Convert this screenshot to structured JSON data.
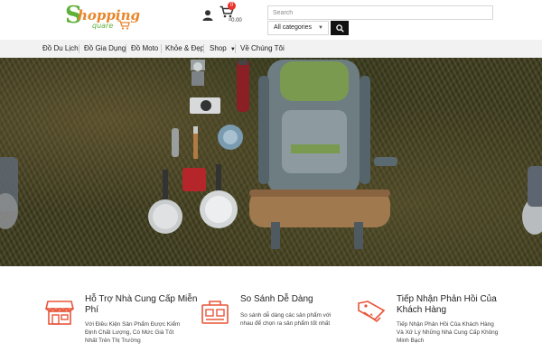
{
  "header": {
    "logo": {
      "big_letter": "S",
      "word1": "hopping",
      "word2": "quare"
    },
    "cart": {
      "count": "0",
      "total": "₫0.00"
    },
    "search": {
      "placeholder": "Search",
      "category_selected": "All categories"
    }
  },
  "nav": {
    "items": [
      {
        "label": "Đồ Du Lịch"
      },
      {
        "label": "Đồ Gia Dụng"
      },
      {
        "label": "Đồ Moto"
      },
      {
        "label": "Khỏe & Đẹp"
      },
      {
        "label": "Shop"
      },
      {
        "label": "Về Chúng Tôi"
      }
    ]
  },
  "features": [
    {
      "title_line1": "Hỗ Trợ Nhà Cung Cấp Miễn",
      "title_line2": "Phí",
      "desc_lines": [
        "Với Điều Kiện Sản Phẩm Được Kiểm",
        "Định Chất Lượng, Có Mức Giá Tốt",
        "Nhất Trên Thị Trường"
      ]
    },
    {
      "title_line1": "So Sánh Dễ Dàng",
      "title_line2": "",
      "desc_lines": [
        "So sánh dễ dàng các sản phẩm với",
        "nhau để chọn ra sản phẩm tốt nhất"
      ]
    },
    {
      "title_line1": "Tiếp Nhận Phản Hồi Của",
      "title_line2": "Khách Hàng",
      "desc_lines": [
        "Tiếp Nhận Phản Hồi Của Khách Hàng",
        "Và Xử Lý Những Nhà Cung Cấp Không",
        "Minh Bạch"
      ]
    }
  ],
  "colors": {
    "accent": "#e8852a",
    "logo_green": "#5fb13a",
    "badge": "#e8322a",
    "feature_icon": "#e8553a"
  }
}
